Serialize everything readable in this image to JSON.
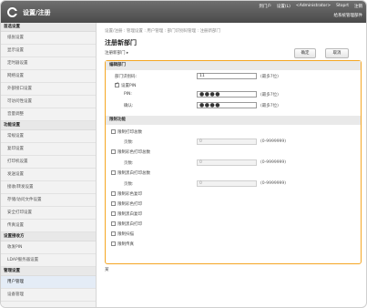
{
  "header": {
    "app_title": "设置/注册",
    "links": [
      "到门户",
      "设置(L)",
      "<Administrator>",
      "Stoprt",
      "注销"
    ],
    "sub_link": "给系统管理部件"
  },
  "sidebar": {
    "items": [
      {
        "type": "section",
        "label": "首选设置"
      },
      {
        "type": "item",
        "label": "纸张设置"
      },
      {
        "type": "item",
        "label": "显示设置"
      },
      {
        "type": "item",
        "label": "定时器设置"
      },
      {
        "type": "item",
        "label": "网络设置"
      },
      {
        "type": "item",
        "label": "外部接口设置"
      },
      {
        "type": "item",
        "label": "可访问性设置"
      },
      {
        "type": "item",
        "label": "音量调整"
      },
      {
        "type": "section",
        "label": "功能设置"
      },
      {
        "type": "item",
        "label": "常规设置"
      },
      {
        "type": "item",
        "label": "复印设置"
      },
      {
        "type": "item",
        "label": "打印机设置"
      },
      {
        "type": "item",
        "label": "发送设置"
      },
      {
        "type": "item",
        "label": "接收/转发设置"
      },
      {
        "type": "item",
        "label": "存储/访问文件设置"
      },
      {
        "type": "item",
        "label": "安全打印设置"
      },
      {
        "type": "item",
        "label": "传真设置"
      },
      {
        "type": "section",
        "label": "设置接收方"
      },
      {
        "type": "item",
        "label": "收发PIN"
      },
      {
        "type": "item",
        "label": "LDAP服务器设置"
      },
      {
        "type": "section",
        "label": "管理设置"
      },
      {
        "type": "item",
        "label": "用户管理",
        "active": true
      },
      {
        "type": "item",
        "label": "设备管理"
      }
    ]
  },
  "main": {
    "breadcrumb": "设置/注册 : 管理设置 : 用户管理 : 部门识别码管理 : 注册新部门",
    "title": "注册新部门",
    "subtitle": "注册新部门",
    "ok_label": "确定",
    "cancel_label": "取消",
    "section_basic": "编辑部门",
    "dept_id_label": "部门识别码:",
    "dept_id_value": "11",
    "dept_id_hint": "(最多7位)",
    "set_pin_label": "设置PIN",
    "pin_label": "PIN:",
    "pin_value": "●●●●",
    "pin_hint": "(最多7位)",
    "confirm_label": "确认:",
    "confirm_value": "●●●●",
    "confirm_hint": "(最多7位)",
    "section_limits": "限制功能",
    "limits": [
      {
        "label": "限制打印总数",
        "page_label": "页数:",
        "value": "0",
        "range": "(0-9999999)"
      },
      {
        "label": "限制彩色打印总数",
        "page_label": "页数:",
        "value": "0",
        "range": "(0-9999999)"
      },
      {
        "label": "限制黑白打印总数",
        "page_label": "页数:",
        "value": "0",
        "range": "(0-9999999)"
      }
    ],
    "simple_limits": [
      "限制彩色复印",
      "限制彩色打印",
      "限制黑白复印",
      "限制黑白打印",
      "限制扫描",
      "限制传真"
    ],
    "footnote": "某"
  }
}
